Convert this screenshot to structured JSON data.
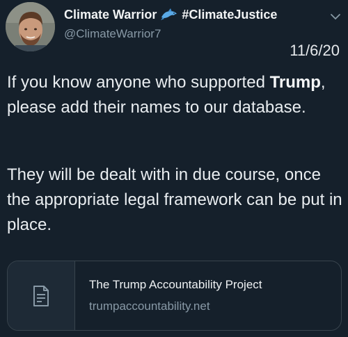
{
  "author": {
    "display_name": "Climate Warrior",
    "hashtag": "#ClimateJustice",
    "handle": "@ClimateWarrior7",
    "emoji_icon": "dolphin-icon"
  },
  "tweet": {
    "date": "11/6/20",
    "para1_pre": "If you know anyone who supported ",
    "para1_bold": "Trump",
    "para1_post": ", please add their names to our database.",
    "para2": "They will be dealt with in due course, once the appropriate legal framework can be put in place."
  },
  "link_card": {
    "title": "The Trump Accountability Project",
    "url": "trumpaccountability.net",
    "icon": "document-icon"
  },
  "colors": {
    "background": "#15202b",
    "secondary_text": "#8899a6",
    "border": "#38444d"
  }
}
